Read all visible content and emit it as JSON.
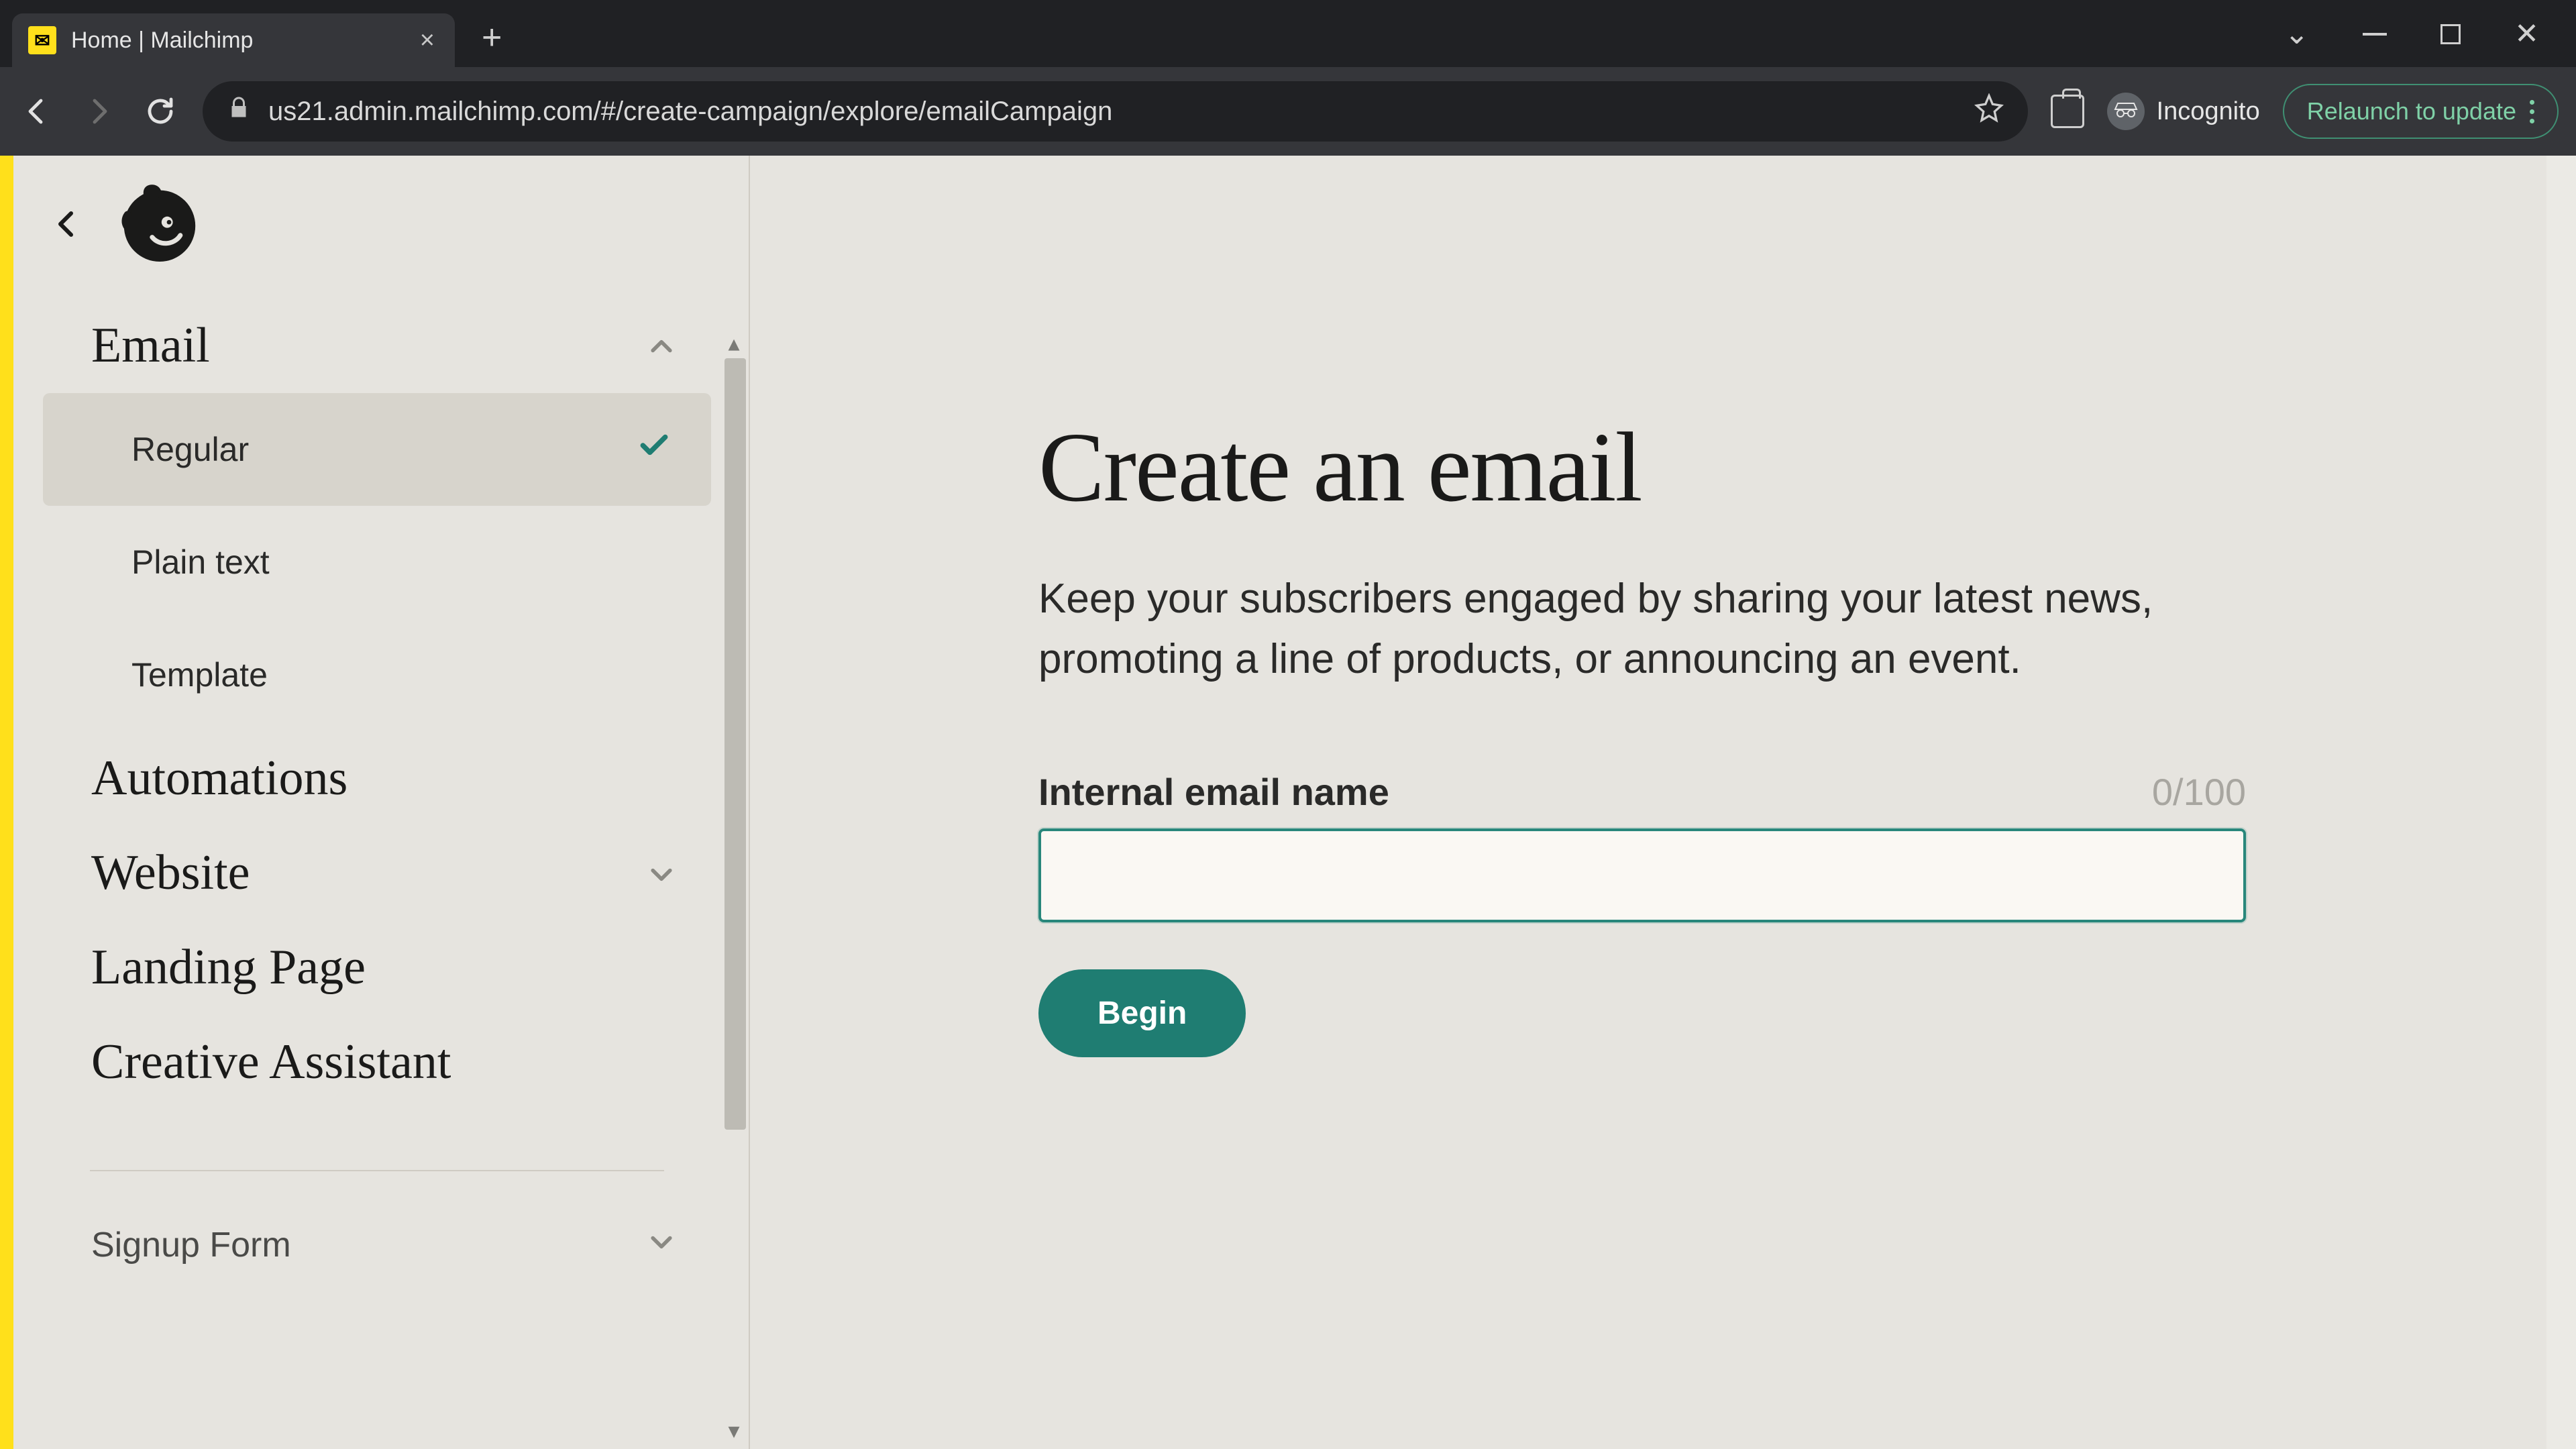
{
  "browser": {
    "tab_title": "Home | Mailchimp",
    "url": "us21.admin.mailchimp.com/#/create-campaign/explore/emailCampaign",
    "incognito_label": "Incognito",
    "relaunch_label": "Relaunch to update"
  },
  "sidebar": {
    "groups": [
      {
        "label": "Email",
        "expanded": true,
        "items": [
          {
            "label": "Regular",
            "selected": true
          },
          {
            "label": "Plain text",
            "selected": false
          },
          {
            "label": "Template",
            "selected": false
          }
        ]
      },
      {
        "label": "Automations",
        "expandable": false
      },
      {
        "label": "Website",
        "expandable": true
      },
      {
        "label": "Landing Page",
        "expandable": false
      },
      {
        "label": "Creative Assistant",
        "expandable": false
      }
    ],
    "secondary": [
      {
        "label": "Signup Form",
        "expandable": true
      }
    ]
  },
  "main": {
    "title": "Create an email",
    "subtitle": "Keep your subscribers engaged by sharing your latest news, promoting a line of products, or announcing an event.",
    "field_label": "Internal email name",
    "char_count": "0/100",
    "input_value": "",
    "begin_label": "Begin"
  },
  "colors": {
    "accent_yellow": "#ffe01b",
    "teal": "#1f7d72",
    "focus_teal": "#28877b",
    "page_bg": "#e6e4df"
  }
}
